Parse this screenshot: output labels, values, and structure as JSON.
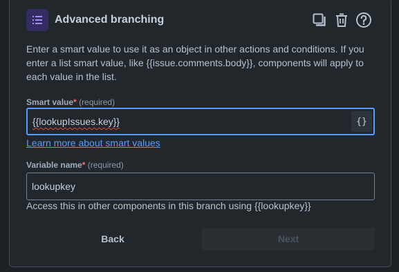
{
  "header": {
    "title": "Advanced branching",
    "icon": "list-icon",
    "actions": [
      "duplicate-icon",
      "trash-icon",
      "help-icon"
    ]
  },
  "description": "Enter a smart value to use it as an object in other actions and conditions. If you enter a list smart value, like {{issue.comments.body}}, components will apply to each value in the list.",
  "smart_value": {
    "label": "Smart value",
    "required_mark": "*",
    "required_text": "(required)",
    "value": "{{lookupIssues.key}}",
    "brace_button": "{}"
  },
  "learn_more_link": "Learn more about smart values",
  "variable_name": {
    "label": "Variable name",
    "required_mark": "*",
    "required_text": "(required)",
    "value": "lookupkey",
    "helper": "Access this in other components in this branch using {{lookupkey}}"
  },
  "buttons": {
    "back": "Back",
    "next": "Next"
  },
  "colors": {
    "accent_blue": "#579dff",
    "required_red": "#f87168",
    "icon_bg": "#352c63",
    "icon_fg": "#9f8fef"
  }
}
